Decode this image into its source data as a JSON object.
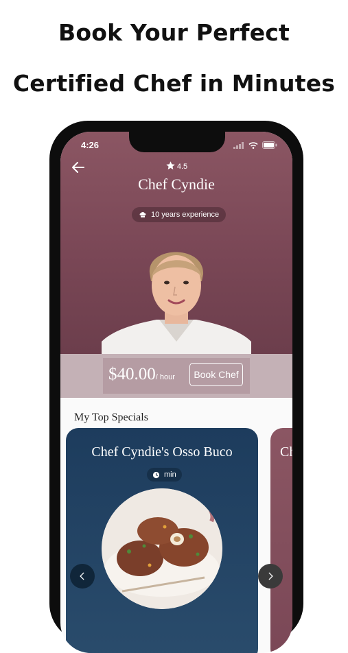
{
  "headline": {
    "line1": "Book Your Perfect",
    "line2": "Certified Chef in Minutes"
  },
  "status_bar": {
    "time": "4:26",
    "icons": [
      "signal-icon",
      "wifi-icon",
      "battery-icon"
    ]
  },
  "chef": {
    "rating": "4.5",
    "name": "Chef Cyndie",
    "experience": "10 years experience",
    "price": "$40.00",
    "price_unit": "/ hour",
    "book_label": "Book Chef"
  },
  "specials": {
    "title": "My Top Specials",
    "cards": [
      {
        "title": "Chef Cyndie's Osso Buco",
        "time": "min"
      },
      {
        "title": "Ch"
      }
    ]
  },
  "colors": {
    "hero": "#7a4756",
    "price_bar": "#c4b1b6",
    "card_primary": "#1d3c5d",
    "card_secondary": "#7a4756"
  },
  "icons": {
    "back": "back-arrow-icon",
    "star": "star-icon",
    "experience": "chef-hat-icon",
    "clock": "clock-icon",
    "prev": "chevron-left-icon",
    "next": "chevron-right-icon"
  }
}
